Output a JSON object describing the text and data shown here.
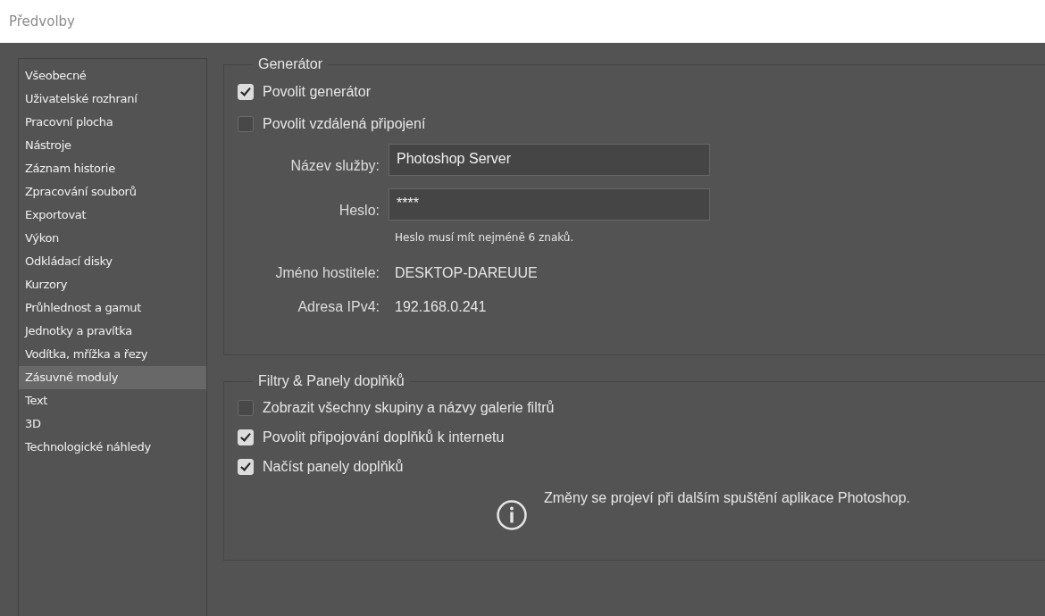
{
  "window": {
    "title": "Předvolby"
  },
  "sidebar": {
    "items": [
      {
        "label": "Všeobecné",
        "selected": false
      },
      {
        "label": "Uživatelské rozhraní",
        "selected": false
      },
      {
        "label": "Pracovní plocha",
        "selected": false
      },
      {
        "label": "Nástroje",
        "selected": false
      },
      {
        "label": "Záznam historie",
        "selected": false
      },
      {
        "label": "Zpracování souborů",
        "selected": false
      },
      {
        "label": "Exportovat",
        "selected": false
      },
      {
        "label": "Výkon",
        "selected": false
      },
      {
        "label": "Odkládací disky",
        "selected": false
      },
      {
        "label": "Kurzory",
        "selected": false
      },
      {
        "label": "Průhlednost a gamut",
        "selected": false
      },
      {
        "label": "Jednotky a pravítka",
        "selected": false
      },
      {
        "label": "Vodítka, mřížka a řezy",
        "selected": false
      },
      {
        "label": "Zásuvné moduly",
        "selected": true
      },
      {
        "label": "Text",
        "selected": false
      },
      {
        "label": "3D",
        "selected": false
      },
      {
        "label": "Technologické náhledy",
        "selected": false
      }
    ]
  },
  "generator": {
    "title": "Generátor",
    "checkboxes": [
      {
        "label": "Povolit generátor",
        "checked": true
      },
      {
        "label": "Povolit vzdálená připojení",
        "checked": false
      }
    ],
    "fields": [
      {
        "label": "Název služby:",
        "value": "Photoshop Server"
      },
      {
        "label": "Heslo:",
        "value": "****"
      }
    ],
    "hint": "Heslo musí mít nejméně 6 znaků.",
    "info": [
      {
        "label": "Jméno hostitele:",
        "value": "DESKTOP-DAREUUE"
      },
      {
        "label": "Adresa IPv4:",
        "value": "192.168.0.241"
      }
    ]
  },
  "plugins": {
    "title": "Filtry & Panely doplňků",
    "checkboxes": [
      {
        "label": "Zobrazit všechny skupiny a názvy galerie filtrů",
        "checked": false
      },
      {
        "label": "Povolit připojování doplňků k internetu",
        "checked": true
      },
      {
        "label": "Načíst panely doplňků",
        "checked": true
      }
    ],
    "notice": "Změny se projeví při dalším spuštění aplikace Photoshop."
  }
}
